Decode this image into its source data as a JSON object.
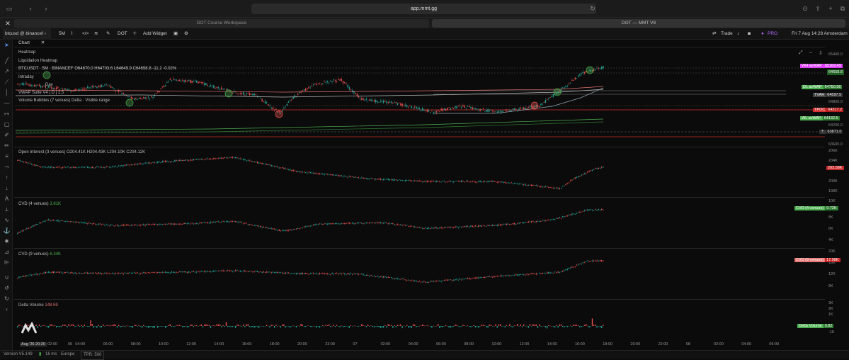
{
  "browser": {
    "url": "app.mmt.gg",
    "tabs": [
      "DOT Course Workspace",
      "DOT — MMT V8"
    ]
  },
  "toolbar": {
    "symbol": "btcusd @ binancef",
    "interval": "5M",
    "layout": "DOT",
    "add_widget": "Add Widget",
    "trade": "Trade",
    "pro": "PRO",
    "datetime": "Fri 7 Aug  14:28  Amsterdam"
  },
  "chart": {
    "tab": "Chart",
    "heatmap_label": "Heatmap",
    "liq_label": "Liquidation Heatmap",
    "ohlc": "BTCUSDT · 5M · BINANCEF  O64670.0  H64703.6  L64649.9  C64658.8  -11.2  -0.02%",
    "intraday_label": "Intraday",
    "vwap_suite": "VWAP Suite V4 | D | 1.5",
    "day_label": "Day",
    "volume_bubbles": "Volume Bubbles (7 venues) Delta · Visible range",
    "price_ticks": [
      "65400.0",
      "64800.0",
      "64200.0",
      "63871.0",
      "63600.0"
    ],
    "badges": [
      {
        "label": "WH avWAP",
        "value": "65169.49",
        "color": "#e040fb"
      },
      {
        "label": "DL avWAP",
        "value": "64750.56",
        "color": "#4caf50"
      },
      {
        "label": "TVAH",
        "value": "64597.5",
        "color": "#555555"
      },
      {
        "label": "TPOC",
        "value": "64317.2",
        "color": "#d32f2f"
      },
      {
        "label": "WL avWAP",
        "value": "64132.5",
        "color": "#4caf50"
      }
    ],
    "last_price_tag": "64658.8",
    "cursor_price": "63871.0"
  },
  "panes": {
    "oi": {
      "label": "Open Interest (3 venues)  O204.41K  H204.43K  L204.10K  C204.12K",
      "ticks": [
        "206K",
        "204K",
        "200K",
        "198K"
      ],
      "tag": "203.58K"
    },
    "cvd4": {
      "label": "CVD (4 venues)",
      "value": "3.81K",
      "ticks": [
        "10K",
        "8K",
        "6K",
        "4K"
      ],
      "badge_label": "CVD (4 venues)",
      "badge_value": "9.72K"
    },
    "cvd9": {
      "label": "CVD (9 venues)",
      "value": "6.34K",
      "ticks": [
        "20K",
        "16K",
        "12K",
        "8K"
      ],
      "badge_label": "CVD (9 venues)",
      "badge_value": "17.08K"
    },
    "delta": {
      "label": "Delta Volume",
      "value": "148.59",
      "ticks": [
        "3K",
        "2K",
        "1K",
        "-1K"
      ],
      "badge_label": "Delta Volume",
      "badge_value": "0.82"
    }
  },
  "time_axis": [
    "Aug '26 20:20",
    "02:00",
    "04:00",
    "06:00",
    "08:00",
    "10:00",
    "12:00",
    "14:00",
    "16:00",
    "18:00",
    "20:00",
    "22:00",
    "07",
    "02:00",
    "04:00",
    "06:00",
    "08:00",
    "10:00",
    "12:00",
    "14:00",
    "16:00",
    "18:00",
    "20:00",
    "22:00",
    "08",
    "02:00",
    "04:00",
    "06:00"
  ],
  "time_axis_left": "06",
  "status": {
    "version": "Version V5.149",
    "latency": "16 ms",
    "region": "Europe",
    "tpr": "TPR: 500"
  }
}
